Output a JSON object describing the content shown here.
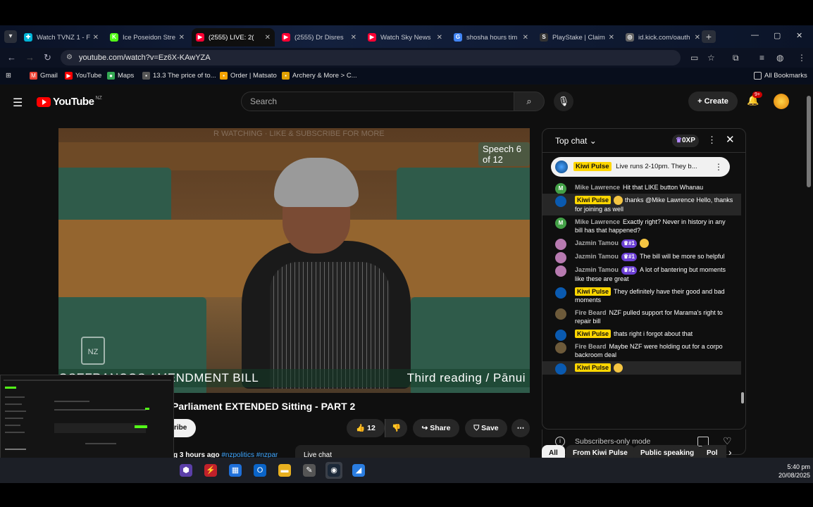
{
  "tabs": [
    {
      "label": "Watch TVNZ 1 - F",
      "color": "#00b5d8",
      "glyph": "✚",
      "active": false
    },
    {
      "label": "Ice Poseidon Stre",
      "color": "#53fc18",
      "glyph": "K",
      "active": false
    },
    {
      "label": "(2555) LIVE: 2(",
      "color": "#ff0033",
      "glyph": "▶",
      "active": true
    },
    {
      "label": "(2555) Dr Disres",
      "color": "#ff0033",
      "glyph": "▶",
      "active": false
    },
    {
      "label": "Watch Sky News",
      "color": "#ff0033",
      "glyph": "▶",
      "active": false
    },
    {
      "label": "shosha hours tim",
      "color": "#4285f4",
      "glyph": "G",
      "active": false
    },
    {
      "label": "PlayStake | Claim",
      "color": "#333333",
      "glyph": "S",
      "active": false
    },
    {
      "label": "id.kick.com/oauth",
      "color": "#666666",
      "glyph": "◎",
      "active": false
    }
  ],
  "omnibar": {
    "url": "youtube.com/watch?v=Ez6X-KAwYZA"
  },
  "bookmarks": [
    {
      "label": "Gmail",
      "color": "#ea4335",
      "glyph": "M"
    },
    {
      "label": "YouTube",
      "color": "#ff0000",
      "glyph": "▶"
    },
    {
      "label": "Maps",
      "color": "#34a853",
      "glyph": "●"
    },
    {
      "label": "13.3 The price of to...",
      "color": "#555555",
      "glyph": "▪"
    },
    {
      "label": "Order | Matsato",
      "color": "#f4a300",
      "glyph": "▪"
    },
    {
      "label": "Archery & More > C...",
      "color": "#e0a000",
      "glyph": "▪"
    }
  ],
  "all_bookmarks": "All Bookmarks",
  "yt": {
    "logo": "YouTube",
    "country": "NZ",
    "search_placeholder": "Search",
    "create": "Create",
    "notif_count": "9+"
  },
  "video": {
    "speech_badge": "Speech 6 of 12",
    "lower_left": "OSEFRANCOS AMENDMENT BILL",
    "lower_right": "Third reading / Pānui",
    "crest": "NZ",
    "overlay": "R WATCHING · LIKE & SUBSCRIBE FOR MORE",
    "title": "Parliament EXTENDED Sitting - PART 2",
    "subscribe": "ribe",
    "likes": "12",
    "share": "Share",
    "save": "Save",
    "meta_time": "g 3 hours ago",
    "meta_tags": "#nzpolitics #nzpar",
    "live_chat": "Live chat"
  },
  "chat": {
    "title": "Top chat",
    "xp": "0XP",
    "pinned_author": "Kiwi Pulse",
    "pinned_text": "Live runs 2-10pm. They b...",
    "messages": [
      {
        "author": "Mike Lawrence",
        "owner": false,
        "rank": "",
        "text": "Hit that LIKE button Whanau",
        "emoji": false,
        "avatar": "M",
        "avcolor": "#43a047",
        "hl": false
      },
      {
        "author": "Kiwi Pulse",
        "owner": true,
        "rank": "",
        "text": "thanks @Mike Lawrence Hello, thanks for joining as well",
        "emoji": true,
        "avatar": "",
        "avcolor": "#0a5ab0",
        "hl": true
      },
      {
        "author": "Mike Lawrence",
        "owner": false,
        "rank": "",
        "text": "Exactly right? Never in history in any bill has that happened?",
        "emoji": false,
        "avatar": "M",
        "avcolor": "#43a047",
        "hl": false
      },
      {
        "author": "Jazmin Tamou",
        "owner": false,
        "rank": "#1",
        "text": "",
        "emoji": true,
        "avatar": "",
        "avcolor": "#b77ab0",
        "hl": false
      },
      {
        "author": "Jazmin Tamou",
        "owner": false,
        "rank": "#1",
        "text": "The bill will be more so helpful",
        "emoji": false,
        "avatar": "",
        "avcolor": "#b77ab0",
        "hl": false
      },
      {
        "author": "Jazmin Tamou",
        "owner": false,
        "rank": "#1",
        "text": "A lot of bantering but moments like these are great",
        "emoji": false,
        "avatar": "",
        "avcolor": "#b77ab0",
        "hl": false
      },
      {
        "author": "Kiwi Pulse",
        "owner": true,
        "rank": "",
        "text": "They definitely have their good and bad moments",
        "emoji": false,
        "avatar": "",
        "avcolor": "#0a5ab0",
        "hl": false
      },
      {
        "author": "Fire Beard",
        "owner": false,
        "rank": "",
        "text": "NZF pulled support for Marama's right to repair bill",
        "emoji": false,
        "avatar": "",
        "avcolor": "#6d5a3a",
        "hl": false
      },
      {
        "author": "Kiwi Pulse",
        "owner": true,
        "rank": "",
        "text": "thats right i forgot about that",
        "emoji": false,
        "avatar": "",
        "avcolor": "#0a5ab0",
        "hl": false
      },
      {
        "author": "Fire Beard",
        "owner": false,
        "rank": "",
        "text": "Maybe NZF were holding out for a corpo backroom deal",
        "emoji": false,
        "avatar": "",
        "avcolor": "#6d5a3a",
        "hl": false
      },
      {
        "author": "Kiwi Pulse",
        "owner": true,
        "rank": "",
        "text": "",
        "emoji": true,
        "avatar": "",
        "avcolor": "#0a5ab0",
        "hl": true
      }
    ],
    "footer": "Subscribers-only mode"
  },
  "chips": [
    "All",
    "From Kiwi Pulse",
    "Public speaking",
    "Pol"
  ],
  "taskbar": {
    "icons": [
      {
        "name": "app-icon",
        "color": "#5b3fa8",
        "glyph": "⬢"
      },
      {
        "name": "bolt-icon",
        "color": "#c0202a",
        "glyph": "⚡"
      },
      {
        "name": "store-icon",
        "color": "#1e6fd9",
        "glyph": "▦"
      },
      {
        "name": "outlook-icon",
        "color": "#0a64c8",
        "glyph": "O"
      },
      {
        "name": "folder-icon",
        "color": "#e8b020",
        "glyph": "▬"
      },
      {
        "name": "pen-icon",
        "color": "#555555",
        "glyph": "✎"
      },
      {
        "name": "steam-icon",
        "color": "#1b2838",
        "glyph": "◉"
      },
      {
        "name": "paint-icon",
        "color": "#2a7de1",
        "glyph": "◢"
      }
    ],
    "time": "5:40 pm",
    "date": "20/08/2025"
  }
}
